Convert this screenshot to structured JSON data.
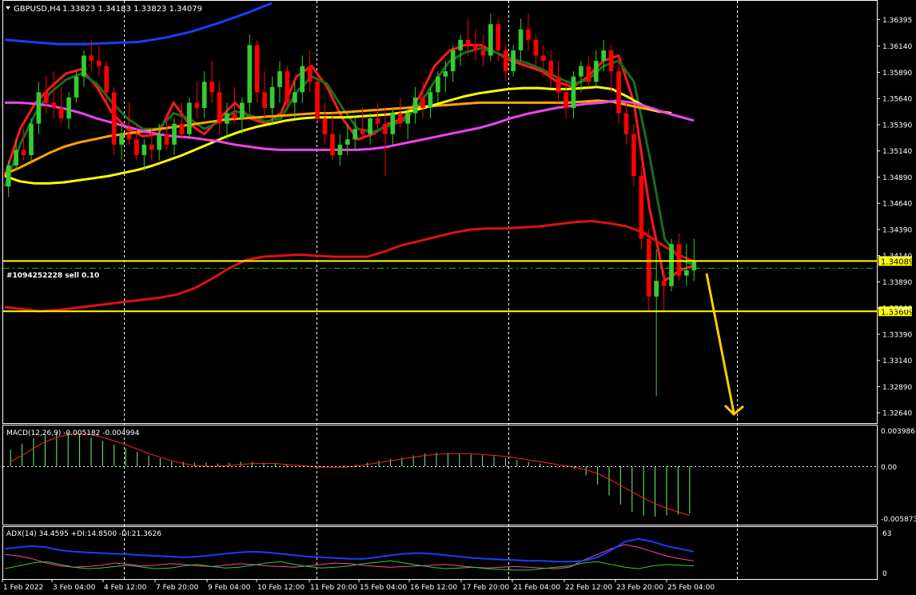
{
  "header": {
    "symbol": "GBPUSD,H4",
    "ohlc": "1.33823 1.34183 1.33823 1.34079"
  },
  "order_label": "#1094252228 sell 0.10",
  "price_tags": {
    "upper": "1.34089",
    "lower": "1.33609"
  },
  "price_axis": [
    "1.36395",
    "1.36140",
    "1.35890",
    "1.35640",
    "1.35390",
    "1.35140",
    "1.34890",
    "1.34640",
    "1.34390",
    "1.34140",
    "1.33890",
    "1.33640",
    "1.33390",
    "1.33140",
    "1.32890",
    "1.32640"
  ],
  "time_axis": [
    "1 Feb 2022",
    "3 Feb 04:00",
    "4 Feb 12:00",
    "7 Feb 20:00",
    "9 Feb 04:00",
    "10 Feb 12:00",
    "11 Feb 20:00",
    "15 Feb 04:00",
    "16 Feb 12:00",
    "17 Feb 20:00",
    "21 Feb 04:00",
    "22 Feb 12:00",
    "23 Feb 20:00",
    "25 Feb 04:00"
  ],
  "macd": {
    "label": "MACD(12,26,9) -0.005182 -0.004994",
    "ticks": [
      "0.003986",
      "0.00",
      "-0.005873"
    ]
  },
  "adx": {
    "label": "ADX(14) 34.4595 +DI:14.8500 -DI:21.3626",
    "ticks": [
      "63",
      "0"
    ]
  },
  "colors": {
    "bull": "#32cd32",
    "bear": "#ff0000",
    "ma_red": "#ff1a1a",
    "ma_darkgreen": "#1a6e1a",
    "ma_orange": "#ffa500",
    "ma_yellow": "#ffff00",
    "ma_magenta": "#ee44ee",
    "ma_blue": "#1a3dff",
    "ma_200": "#e01010",
    "hline": "#ffff00",
    "order_line": "#22bb22",
    "arrow": "#ffcc00",
    "macd_hist": "#66ff66",
    "macd_signal": "#ff2222",
    "adx_main": "#1a3dff",
    "adx_plus": "#32cd32",
    "adx_minus": "#ff44aa"
  },
  "chart_data": {
    "type": "candlestick",
    "ylim": [
      1.3255,
      1.3655
    ],
    "hlines": [
      1.34089,
      1.33609
    ],
    "order_line": 1.3402,
    "candles": [
      [
        1.348,
        1.3505,
        1.347,
        1.35
      ],
      [
        1.35,
        1.3525,
        1.3495,
        1.3515
      ],
      [
        1.3515,
        1.3535,
        1.3505,
        1.351
      ],
      [
        1.351,
        1.3545,
        1.3505,
        1.354
      ],
      [
        1.354,
        1.358,
        1.353,
        1.357
      ],
      [
        1.357,
        1.3585,
        1.355,
        1.356
      ],
      [
        1.356,
        1.359,
        1.3545,
        1.3555
      ],
      [
        1.3555,
        1.3575,
        1.354,
        1.3545
      ],
      [
        1.3545,
        1.357,
        1.3535,
        1.3565
      ],
      [
        1.3565,
        1.359,
        1.356,
        1.3585
      ],
      [
        1.3585,
        1.361,
        1.3575,
        1.3605
      ],
      [
        1.3605,
        1.362,
        1.359,
        1.36
      ],
      [
        1.36,
        1.3615,
        1.3585,
        1.3595
      ],
      [
        1.3595,
        1.36,
        1.356,
        1.357
      ],
      [
        1.357,
        1.3575,
        1.351,
        1.352
      ],
      [
        1.352,
        1.354,
        1.3505,
        1.353
      ],
      [
        1.353,
        1.356,
        1.352,
        1.3525
      ],
      [
        1.3525,
        1.354,
        1.3505,
        1.351
      ],
      [
        1.351,
        1.3525,
        1.3495,
        1.352
      ],
      [
        1.352,
        1.3535,
        1.3505,
        1.3515
      ],
      [
        1.3515,
        1.354,
        1.3505,
        1.353
      ],
      [
        1.353,
        1.355,
        1.3515,
        1.352
      ],
      [
        1.352,
        1.3545,
        1.351,
        1.354
      ],
      [
        1.354,
        1.356,
        1.3525,
        1.353
      ],
      [
        1.353,
        1.3565,
        1.3525,
        1.356
      ],
      [
        1.356,
        1.358,
        1.3545,
        1.3555
      ],
      [
        1.3555,
        1.359,
        1.3545,
        1.358
      ],
      [
        1.358,
        1.36,
        1.356,
        1.357
      ],
      [
        1.357,
        1.358,
        1.353,
        1.354
      ],
      [
        1.354,
        1.356,
        1.3525,
        1.355
      ],
      [
        1.355,
        1.3575,
        1.354,
        1.3545
      ],
      [
        1.3545,
        1.3565,
        1.353,
        1.356
      ],
      [
        1.356,
        1.3625,
        1.355,
        1.3615
      ],
      [
        1.3615,
        1.362,
        1.356,
        1.357
      ],
      [
        1.357,
        1.359,
        1.3545,
        1.3555
      ],
      [
        1.3555,
        1.3585,
        1.354,
        1.3575
      ],
      [
        1.3575,
        1.36,
        1.356,
        1.359
      ],
      [
        1.359,
        1.3595,
        1.3555,
        1.356
      ],
      [
        1.356,
        1.358,
        1.3545,
        1.357
      ],
      [
        1.357,
        1.3605,
        1.356,
        1.3595
      ],
      [
        1.3595,
        1.361,
        1.357,
        1.358
      ],
      [
        1.358,
        1.359,
        1.354,
        1.3545
      ],
      [
        1.3545,
        1.356,
        1.352,
        1.353
      ],
      [
        1.353,
        1.355,
        1.3505,
        1.351
      ],
      [
        1.351,
        1.353,
        1.35,
        1.352
      ],
      [
        1.352,
        1.354,
        1.351,
        1.3525
      ],
      [
        1.3525,
        1.3545,
        1.3515,
        1.3535
      ],
      [
        1.3535,
        1.3555,
        1.3525,
        1.353
      ],
      [
        1.353,
        1.355,
        1.352,
        1.3545
      ],
      [
        1.3545,
        1.356,
        1.3535,
        1.354
      ],
      [
        1.354,
        1.3555,
        1.349,
        1.353
      ],
      [
        1.353,
        1.3555,
        1.352,
        1.355
      ],
      [
        1.355,
        1.3565,
        1.3535,
        1.354
      ],
      [
        1.354,
        1.3555,
        1.3525,
        1.355
      ],
      [
        1.355,
        1.3575,
        1.354,
        1.3565
      ],
      [
        1.3565,
        1.358,
        1.3545,
        1.3555
      ],
      [
        1.3555,
        1.3575,
        1.3545,
        1.357
      ],
      [
        1.357,
        1.359,
        1.356,
        1.3585
      ],
      [
        1.3585,
        1.36,
        1.357,
        1.359
      ],
      [
        1.359,
        1.3615,
        1.358,
        1.361
      ],
      [
        1.361,
        1.3625,
        1.3595,
        1.362
      ],
      [
        1.362,
        1.364,
        1.3605,
        1.3615
      ],
      [
        1.3615,
        1.363,
        1.36,
        1.361
      ],
      [
        1.361,
        1.3625,
        1.3595,
        1.3605
      ],
      [
        1.3605,
        1.3645,
        1.36,
        1.3635
      ],
      [
        1.3635,
        1.364,
        1.36,
        1.361
      ],
      [
        1.361,
        1.3615,
        1.358,
        1.359
      ],
      [
        1.359,
        1.3615,
        1.3585,
        1.361
      ],
      [
        1.361,
        1.364,
        1.36,
        1.363
      ],
      [
        1.363,
        1.3645,
        1.361,
        1.362
      ],
      [
        1.362,
        1.3625,
        1.3595,
        1.3605
      ],
      [
        1.3605,
        1.3615,
        1.3585,
        1.36
      ],
      [
        1.36,
        1.361,
        1.3575,
        1.3585
      ],
      [
        1.3585,
        1.36,
        1.356,
        1.357
      ],
      [
        1.357,
        1.358,
        1.3545,
        1.3555
      ],
      [
        1.3555,
        1.359,
        1.3545,
        1.3585
      ],
      [
        1.3585,
        1.36,
        1.357,
        1.3595
      ],
      [
        1.3595,
        1.3605,
        1.3575,
        1.358
      ],
      [
        1.358,
        1.361,
        1.3575,
        1.36
      ],
      [
        1.36,
        1.362,
        1.359,
        1.361
      ],
      [
        1.361,
        1.3615,
        1.357,
        1.359
      ],
      [
        1.359,
        1.36,
        1.354,
        1.355
      ],
      [
        1.355,
        1.356,
        1.352,
        1.353
      ],
      [
        1.353,
        1.354,
        1.348,
        1.349
      ],
      [
        1.349,
        1.35,
        1.342,
        1.343
      ],
      [
        1.343,
        1.344,
        1.336,
        1.3375
      ],
      [
        1.3375,
        1.342,
        1.328,
        1.339
      ],
      [
        1.339,
        1.34,
        1.336,
        1.3385
      ],
      [
        1.3385,
        1.343,
        1.338,
        1.3425
      ],
      [
        1.3425,
        1.3435,
        1.339,
        1.3395
      ],
      [
        1.3395,
        1.3425,
        1.3385,
        1.34
      ],
      [
        1.34,
        1.343,
        1.339,
        1.3408
      ]
    ],
    "series": [
      {
        "name": "",
        "color": "#ff1a1a",
        "values": [
          1.349,
          1.3535,
          1.356,
          1.3575,
          1.3588,
          1.3592,
          1.3575,
          1.355,
          1.3535,
          1.3528,
          1.353,
          1.356,
          1.354,
          1.353,
          1.3545,
          1.356,
          1.3545,
          1.354,
          1.355,
          1.3585,
          1.3595,
          1.3575,
          1.3545,
          1.3525,
          1.353,
          1.354,
          1.3545,
          1.3565,
          1.3595,
          1.361,
          1.3615,
          1.3615,
          1.3608,
          1.36,
          1.3595,
          1.359,
          1.358,
          1.3575,
          1.3585,
          1.36,
          1.3605,
          1.356,
          1.346,
          1.339,
          1.34,
          1.3405
        ]
      },
      {
        "name": "",
        "color": "#1a6e1a",
        "values": [
          1.348,
          1.352,
          1.355,
          1.357,
          1.3582,
          1.3588,
          1.3578,
          1.356,
          1.3545,
          1.3535,
          1.3535,
          1.355,
          1.3545,
          1.3535,
          1.3542,
          1.3552,
          1.3548,
          1.3542,
          1.3545,
          1.357,
          1.3585,
          1.3578,
          1.3555,
          1.3535,
          1.3532,
          1.3538,
          1.3543,
          1.3558,
          1.358,
          1.36,
          1.3608,
          1.3612,
          1.3608,
          1.3602,
          1.3598,
          1.3592,
          1.3584,
          1.3578,
          1.3582,
          1.3595,
          1.36,
          1.358,
          1.351,
          1.343,
          1.341,
          1.3405
        ]
      },
      {
        "name": "",
        "color": "#ffa500",
        "values": [
          1.3492,
          1.3498,
          1.3505,
          1.3512,
          1.3518,
          1.3522,
          1.3525,
          1.3528,
          1.353,
          1.3532,
          1.3534,
          1.3536,
          1.3538,
          1.354,
          1.3542,
          1.3544,
          1.3545,
          1.3546,
          1.3547,
          1.3548,
          1.3549,
          1.355,
          1.355,
          1.3551,
          1.3552,
          1.3553,
          1.3554,
          1.3555,
          1.3556,
          1.3557,
          1.3558,
          1.3559,
          1.356,
          1.356,
          1.356,
          1.356,
          1.356,
          1.356,
          1.356,
          1.3561,
          1.3562,
          1.3561,
          1.3558,
          1.3555,
          1.3552,
          1.355
        ]
      },
      {
        "name": "",
        "color": "#ffff00",
        "values": [
          1.349,
          1.3485,
          1.3483,
          1.3483,
          1.3484,
          1.3486,
          1.3488,
          1.349,
          1.3493,
          1.3496,
          1.35,
          1.3505,
          1.351,
          1.3516,
          1.3522,
          1.3528,
          1.3533,
          1.3537,
          1.354,
          1.3543,
          1.3545,
          1.3546,
          1.3546,
          1.3546,
          1.3547,
          1.3548,
          1.3549,
          1.3551,
          1.3554,
          1.3558,
          1.3562,
          1.3566,
          1.3569,
          1.3571,
          1.3573,
          1.3574,
          1.3574,
          1.3573,
          1.3573,
          1.3574,
          1.3575,
          1.3573,
          1.3566,
          1.3558,
          1.3552,
          1.355
        ]
      },
      {
        "name": "",
        "color": "#ee44ee",
        "values": [
          1.356,
          1.356,
          1.3559,
          1.3557,
          1.3554,
          1.355,
          1.3545,
          1.3541,
          1.3537,
          1.3533,
          1.353,
          1.3528,
          1.3527,
          1.3525,
          1.3523,
          1.352,
          1.3518,
          1.3516,
          1.3515,
          1.3515,
          1.3515,
          1.3515,
          1.3515,
          1.3515,
          1.3516,
          1.3518,
          1.3521,
          1.3524,
          1.3527,
          1.353,
          1.3533,
          1.3536,
          1.354,
          1.3545,
          1.3549,
          1.3552,
          1.3555,
          1.3557,
          1.3559,
          1.356,
          1.3562,
          1.356,
          1.3556,
          1.3551,
          1.3547,
          1.3543
        ]
      },
      {
        "name": "",
        "color": "#1a3dff",
        "values": [
          1.362,
          1.3618,
          1.3616,
          1.3616,
          1.3617,
          1.3618,
          1.3622,
          1.3628,
          1.3636,
          1.3645,
          1.3655
        ]
      },
      {
        "name": "",
        "color": "#e01010",
        "values": [
          1.3365,
          1.3363,
          1.3361,
          1.3362,
          1.3364,
          1.3366,
          1.3368,
          1.337,
          1.3372,
          1.3374,
          1.3377,
          1.3383,
          1.3392,
          1.3402,
          1.341,
          1.3413,
          1.3414,
          1.3415,
          1.3414,
          1.3413,
          1.3413,
          1.3413,
          1.3418,
          1.3424,
          1.3428,
          1.3432,
          1.3436,
          1.3439,
          1.344,
          1.344,
          1.3441,
          1.3442,
          1.3444,
          1.3446,
          1.3447,
          1.3445,
          1.3442,
          1.3436,
          1.3425,
          1.3415,
          1.3408
        ]
      }
    ],
    "macd_hist": [
      0.0018,
      0.0025,
      0.0031,
      0.0035,
      0.0037,
      0.0038,
      0.0036,
      0.0032,
      0.0028,
      0.0024,
      0.002,
      0.0016,
      0.0012,
      0.0009,
      0.0006,
      0.0005,
      0.0004,
      0.0004,
      0.0003,
      0.0004,
      0.0005,
      0.0005,
      0.0004,
      0.0003,
      0.0002,
      0.0001,
      0.0,
      -0.0001,
      0.0,
      0.0001,
      0.0002,
      0.0004,
      0.0006,
      0.0008,
      0.001,
      0.0012,
      0.0014,
      0.0015,
      0.0015,
      0.0014,
      0.0013,
      0.0012,
      0.0011,
      0.0009,
      0.0007,
      0.0005,
      0.0003,
      0.0001,
      -0.0001,
      -0.0003,
      -0.001,
      -0.002,
      -0.0032,
      -0.0042,
      -0.005,
      -0.0054,
      -0.0055,
      -0.0054,
      -0.0053,
      -0.0052
    ],
    "macd_signal": [
      0.0005,
      0.0012,
      0.002,
      0.0027,
      0.0032,
      0.0035,
      0.0036,
      0.0035,
      0.0032,
      0.0028,
      0.0024,
      0.0019,
      0.0014,
      0.001,
      0.0006,
      0.0003,
      0.0001,
      0.0,
      0.0,
      0.0001,
      0.0002,
      0.0003,
      0.0003,
      0.0003,
      0.0002,
      0.0001,
      0.0,
      -0.0001,
      -0.0001,
      -0.0001,
      0.0,
      0.0002,
      0.0004,
      0.0006,
      0.0008,
      0.001,
      0.0012,
      0.0013,
      0.0014,
      0.0014,
      0.0014,
      0.0013,
      0.0012,
      0.0011,
      0.0009,
      0.0007,
      0.0005,
      0.0003,
      0.0001,
      -0.0001,
      -0.0004,
      -0.0008,
      -0.0014,
      -0.0021,
      -0.0028,
      -0.0035,
      -0.0041,
      -0.0046,
      -0.005,
      -0.0054
    ],
    "adx_main": [
      38,
      40,
      42,
      40,
      36,
      34,
      33,
      32,
      31,
      30,
      29,
      28,
      27,
      26,
      27,
      29,
      31,
      33,
      34,
      33,
      31,
      29,
      27,
      26,
      25,
      24,
      24,
      26,
      29,
      31,
      32,
      31,
      29,
      27,
      25,
      24,
      23,
      22,
      21,
      21,
      20,
      20,
      21,
      26,
      36,
      48,
      52,
      48,
      42,
      38,
      34
    ],
    "adx_plus": [
      10,
      14,
      18,
      20,
      16,
      12,
      10,
      11,
      13,
      15,
      12,
      10,
      11,
      14,
      16,
      13,
      11,
      12,
      15,
      18,
      20,
      16,
      13,
      11,
      12,
      14,
      17,
      19,
      21,
      18,
      15,
      12,
      10,
      11,
      12,
      10,
      9,
      8,
      8,
      10,
      12,
      14,
      18,
      20,
      16,
      12,
      10,
      14,
      16,
      15,
      14
    ],
    "adx_minus": [
      30,
      28,
      24,
      18,
      14,
      12,
      13,
      15,
      18,
      16,
      14,
      15,
      17,
      16,
      14,
      13,
      15,
      17,
      16,
      14,
      13,
      12,
      14,
      16,
      18,
      17,
      15,
      13,
      12,
      13,
      14,
      15,
      16,
      14,
      12,
      11,
      12,
      13,
      12,
      11,
      10,
      12,
      22,
      30,
      38,
      44,
      40,
      34,
      28,
      24,
      21
    ]
  }
}
